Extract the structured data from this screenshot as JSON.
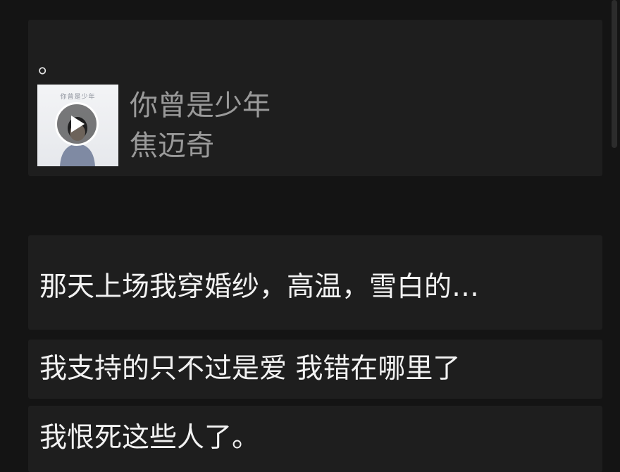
{
  "colors": {
    "background": "#141414",
    "card": "#1e1e1e",
    "primary_text": "#f2f2f2",
    "secondary_text": "#9a9a9a"
  },
  "music_card": {
    "caption": "。",
    "song_title": "你曾是少年",
    "artist": "焦迈奇",
    "cover_text": "你曾是少年",
    "play_icon": "play-icon"
  },
  "messages": [
    "那天上场我穿婚纱，高温，雪白的…",
    "我支持的只不过是爱 我错在哪里了",
    "我恨死这些人了。"
  ]
}
